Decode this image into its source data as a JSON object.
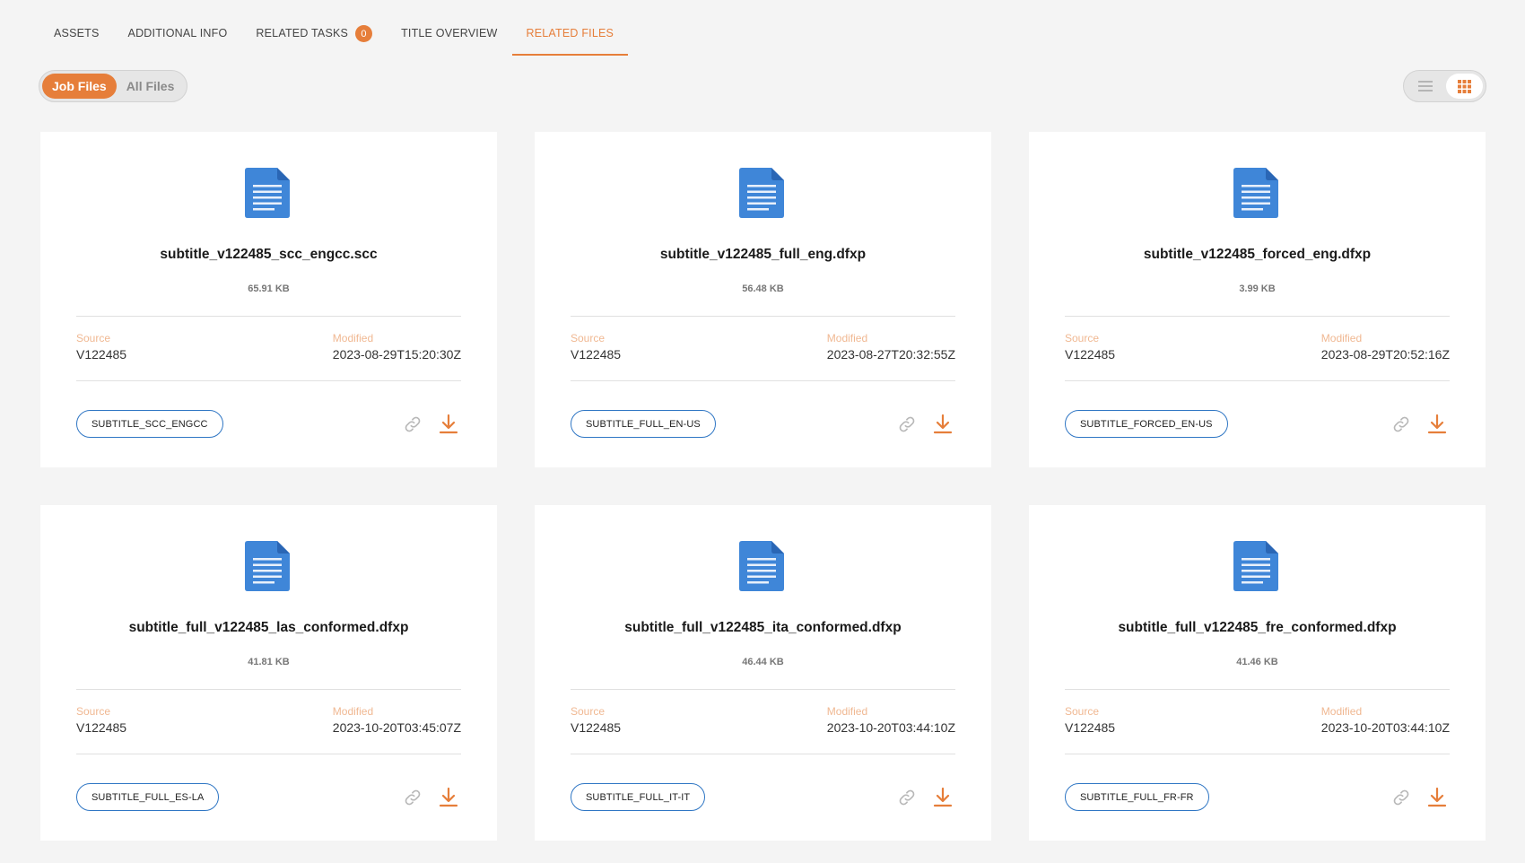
{
  "tabs": [
    {
      "label": "ASSETS",
      "active": false
    },
    {
      "label": "ADDITIONAL INFO",
      "active": false
    },
    {
      "label": "RELATED TASKS",
      "badge": "0",
      "active": false
    },
    {
      "label": "TITLE OVERVIEW",
      "active": false
    },
    {
      "label": "RELATED FILES",
      "active": true
    }
  ],
  "file_filter": {
    "options": [
      "Job Files",
      "All Files"
    ],
    "selected": "Job Files"
  },
  "view_toggle": {
    "options": [
      "list-view-icon",
      "grid-view-icon"
    ],
    "selected": "grid-view-icon"
  },
  "labels": {
    "source": "Source",
    "modified": "Modified"
  },
  "files": [
    {
      "name": "subtitle_v122485_scc_engcc.scc",
      "size": "65.91 KB",
      "source": "V122485",
      "modified": "2023-08-29T15:20:30Z",
      "tag": "SUBTITLE_SCC_ENGCC"
    },
    {
      "name": "subtitle_v122485_full_eng.dfxp",
      "size": "56.48 KB",
      "source": "V122485",
      "modified": "2023-08-27T20:32:55Z",
      "tag": "SUBTITLE_FULL_EN-US"
    },
    {
      "name": "subtitle_v122485_forced_eng.dfxp",
      "size": "3.99 KB",
      "source": "V122485",
      "modified": "2023-08-29T20:52:16Z",
      "tag": "SUBTITLE_FORCED_EN-US"
    },
    {
      "name": "subtitle_full_v122485_las_conformed.dfxp",
      "size": "41.81 KB",
      "source": "V122485",
      "modified": "2023-10-20T03:45:07Z",
      "tag": "SUBTITLE_FULL_ES-LA"
    },
    {
      "name": "subtitle_full_v122485_ita_conformed.dfxp",
      "size": "46.44 KB",
      "source": "V122485",
      "modified": "2023-10-20T03:44:10Z",
      "tag": "SUBTITLE_FULL_IT-IT"
    },
    {
      "name": "subtitle_full_v122485_fre_conformed.dfxp",
      "size": "41.46 KB",
      "source": "V122485",
      "modified": "2023-10-20T03:44:10Z",
      "tag": "SUBTITLE_FULL_FR-FR"
    }
  ],
  "colors": {
    "accent": "#e67e3a",
    "file_icon": "#3f86d8",
    "tag_border": "#2f76c4"
  }
}
